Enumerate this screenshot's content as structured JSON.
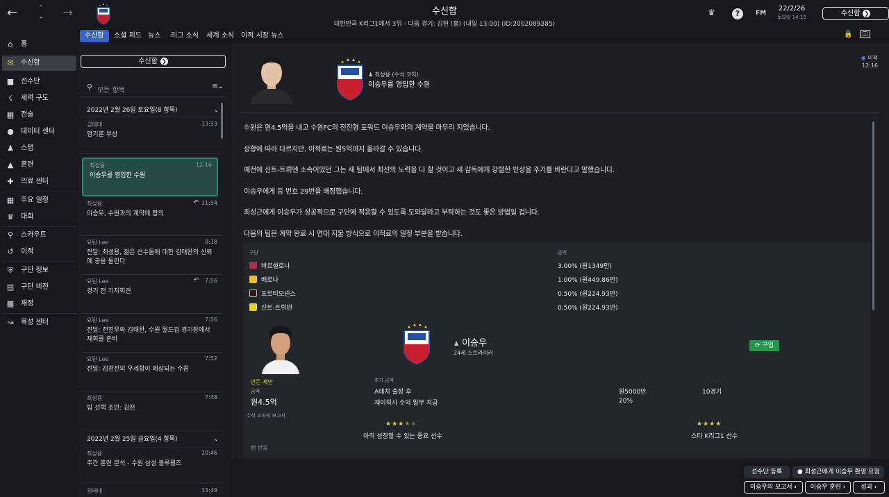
{
  "header": {
    "title": "수신함",
    "subtitle": "대한민국 K리그1에서 3위 - 다음 경기: 김천 (홈) (내일 13:00) (ID:2002089285)",
    "date": "22/2/26",
    "time": "토요일 14:15",
    "continue_label": "수신함",
    "fm_label": "FM"
  },
  "tabs": [
    "수신함",
    "소셜 피드",
    "뉴스",
    "리그 소식",
    "세계 소식",
    "이적 시장 뉴스"
  ],
  "sidebar": [
    {
      "label": "홈",
      "icon": "home-icon"
    },
    {
      "label": "수신함",
      "icon": "inbox-icon"
    },
    {
      "label": "선수단",
      "icon": "shirt-icon"
    },
    {
      "label": "세력 구도",
      "icon": "hierarchy-icon"
    },
    {
      "label": "전술",
      "icon": "tactics-icon"
    },
    {
      "label": "데이터 센터",
      "icon": "data-icon"
    },
    {
      "label": "스탭",
      "icon": "staff-icon"
    },
    {
      "label": "훈련",
      "icon": "training-icon"
    },
    {
      "label": "의료 센터",
      "icon": "medical-icon"
    },
    {
      "label": "주요 일정",
      "icon": "calendar-icon"
    },
    {
      "label": "대회",
      "icon": "trophy-icon"
    },
    {
      "label": "스카우트",
      "icon": "scout-icon"
    },
    {
      "label": "이적",
      "icon": "transfer-icon"
    },
    {
      "label": "구단 정보",
      "icon": "club-info-icon"
    },
    {
      "label": "구단 비전",
      "icon": "club-vision-icon"
    },
    {
      "label": "재정",
      "icon": "finance-icon"
    },
    {
      "label": "육성 센터",
      "icon": "development-icon"
    }
  ],
  "inbox": {
    "button_label": "수신함",
    "search_placeholder": "모든 항목",
    "day1": "2022년 2월 26일 토요일(8 항목)",
    "day2": "2022년 2월 25일 금요일(4 항목)",
    "messages": [
      {
        "from": "김태대",
        "time": "13:53",
        "subject": "염기훈 부상"
      },
      {
        "from": "최성용",
        "time": "12:16",
        "subject": "이승우를 영입한 수원"
      },
      {
        "from": "최성용",
        "time": "11:54",
        "subject": "이승우, 수원과의 계약에 합의"
      },
      {
        "from": "요된 Lee",
        "time": "8:18",
        "subject": "전달: 최성용, 젊은 선수들에 대한 김태완의 신뢰에 공을 돌린다"
      },
      {
        "from": "요된 Lee",
        "time": "7:56",
        "subject": "경기 전 기자회견"
      },
      {
        "from": "요된 Lee",
        "time": "7:56",
        "subject": "전달: 전진우와 김태완, 수원 월드컵 경기장에서 재회를 준비"
      },
      {
        "from": "요된 Lee",
        "time": "7:52",
        "subject": "전달: 김천전의 우세함이 예상되는 수원"
      },
      {
        "from": "최성용",
        "time": "7:48",
        "subject": "팀 선택 조언: 김천"
      },
      {
        "from": "최성용",
        "time": "20:46",
        "subject": "주간 훈련 분석 - 수원 삼성 블루윙즈"
      },
      {
        "from": "김태대",
        "time": "13:49",
        "subject": ""
      }
    ]
  },
  "message": {
    "sender": "최성용 (수석 코치)",
    "headline": "이승우를 영입한 수원",
    "read_label": "이적",
    "time": "12:16",
    "paragraphs": [
      "수원은 원4.5억을 내고 수원FC의 전진형 포워드 이승우와의 계약을 마무리 지었습니다.",
      "상황에 따라 다르지만, 이적료는 원5억까지 올라갈 수 있습니다.",
      "예전에 신트-트뤼덴 소속이었던 그는 새 팀에서 최선의 노력을 다 할 것이고 새 감독에게 강렬한 인상을 주기를 바란다고 말했습니다.",
      "이승우에게 등 번호 29번을 배정했습니다.",
      "최성근에게 이승우가 성공적으로 구단에 적응할 수 있도록 도와달라고 부탁하는 것도 좋은 방법일 겁니다.",
      "다음의 팀은 계약 완료 시 연대 지불 방식으로 이적료의 일정 부분을 받습니다."
    ],
    "club_header": "구단",
    "amount_header": "금액",
    "clubs": [
      {
        "name": "바르셀로나",
        "amount": "3.00% (원1349만)",
        "color": "#a8324a"
      },
      {
        "name": "베로나",
        "amount": "1.00% (원449.86만)",
        "color": "#e8c21e"
      },
      {
        "name": "포르티모넨스",
        "amount": "0.50% (원224.93만)",
        "color": "#1e1e1e"
      },
      {
        "name": "신트-트뤼덴",
        "amount": "0.50% (원224.93만)",
        "color": "#e3d42b"
      }
    ],
    "player": {
      "name": "이승우",
      "desc": "24세 스트라이커",
      "buy_label": "구입"
    },
    "deal": {
      "label": "만든 제안",
      "fee_label": "금액",
      "fee": "원4.5억",
      "add_label": "추가 금액",
      "add1_cond": "A매치 출장 후",
      "add1_val": "원5000만",
      "add1_extra": "10경기",
      "add2_cond": "재이적시 수익 일부 지급",
      "add2_val": "20%",
      "report_label": "수석 코치의 보고서",
      "rating1": "아직 성장할 수 있는 중요 선수",
      "rating1_stars": 3.5,
      "rating2": "스타 K리그1 선수",
      "rating2_stars": 4,
      "more_label": "팬 반응"
    }
  },
  "actions": {
    "register": "선수단 등록",
    "welcome": "최성근에게 이승우 환영 요청",
    "report": "이승우의 보고서",
    "training": "이승우 훈련",
    "result": "성과"
  },
  "colors": {
    "accent": "#3a62c8",
    "selected": "#264a45",
    "buy": "#1f9a4a",
    "star": "#e2d14a"
  }
}
